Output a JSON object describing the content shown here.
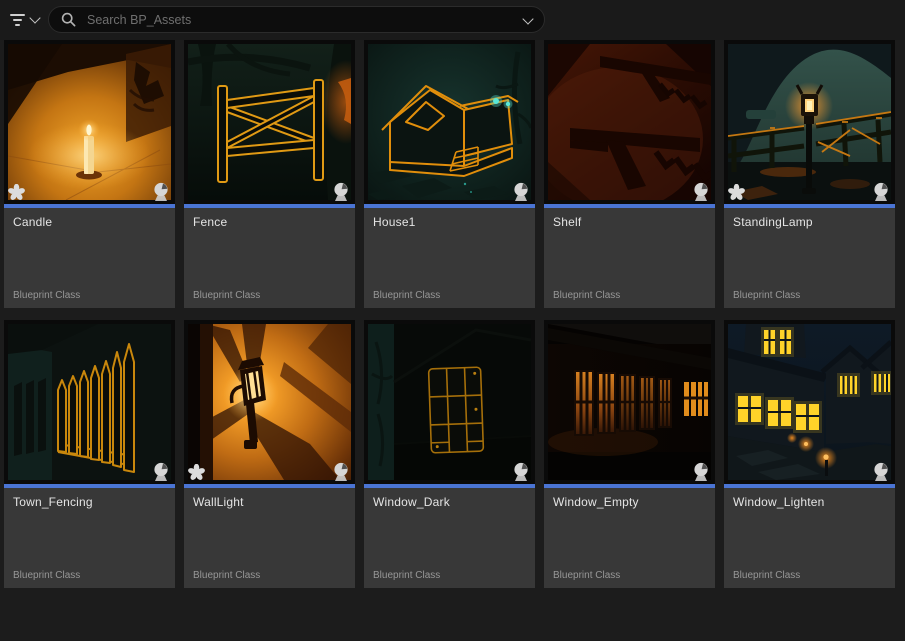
{
  "topbar": {
    "filters_icon": "funnel-lines-with-chevron",
    "search": {
      "placeholder": "Search BP_Assets",
      "search_icon": "magnifier",
      "options_icon": "chevron-down"
    }
  },
  "colors": {
    "blueprint_accent": "#4a74d4",
    "toolbar_bg": "#1a1a1a",
    "tile_info_bg": "#383838",
    "page_bg": "#1c1c1c"
  },
  "icons": {
    "unsaved": "asterisk-star (unsaved changes marker, bottom-left of thumbnail)",
    "preview": "sphere-on-stand (thumbnail preview marker, bottom-right of thumbnail)"
  },
  "grid": {
    "items": [
      {
        "name": "Candle",
        "type": "Blueprint Class",
        "unsaved": true
      },
      {
        "name": "Fence",
        "type": "Blueprint Class",
        "unsaved": false
      },
      {
        "name": "House1",
        "type": "Blueprint Class",
        "unsaved": false
      },
      {
        "name": "Shelf",
        "type": "Blueprint Class",
        "unsaved": false
      },
      {
        "name": "StandingLamp",
        "type": "Blueprint Class",
        "unsaved": true
      },
      {
        "name": "Town_Fencing",
        "type": "Blueprint Class",
        "unsaved": false
      },
      {
        "name": "WallLight",
        "type": "Blueprint Class",
        "unsaved": true
      },
      {
        "name": "Window_Dark",
        "type": "Blueprint Class",
        "unsaved": false
      },
      {
        "name": "Window_Empty",
        "type": "Blueprint Class",
        "unsaved": false
      },
      {
        "name": "Window_Lighten",
        "type": "Blueprint Class",
        "unsaved": false
      }
    ]
  }
}
